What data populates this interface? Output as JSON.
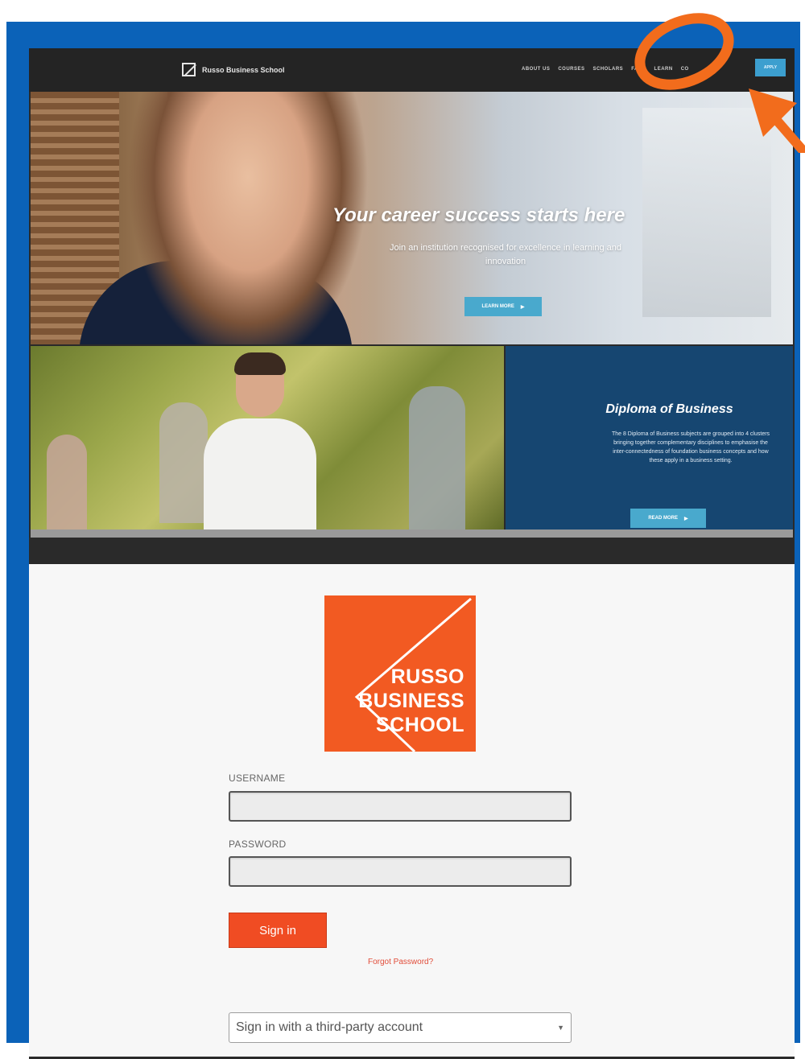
{
  "nav": {
    "brand": "Russo Business School",
    "links": [
      "ABOUT US",
      "COURSES",
      "SCHOLARS",
      "FAQS",
      "LEARN",
      "CO"
    ],
    "apply": "APPLY"
  },
  "hero": {
    "title": "Your career success starts here",
    "subtitle": "Join an institution recognised for excellence in learning and innovation",
    "button": "LEARN MORE",
    "button_arrow": "▶"
  },
  "diploma": {
    "title": "Diploma of Business",
    "text": "The 8 Diploma of Business subjects are grouped into 4 clusters bringing together complementary disciplines to emphasise the inter-connectedness of foundation business concepts and how these apply in a business setting.",
    "button": "READ MORE",
    "button_arrow": "▶"
  },
  "logo": {
    "lines": [
      "RUSSO",
      "BUSINESS",
      "SCHOOL"
    ]
  },
  "login": {
    "username_label": "USERNAME",
    "password_label": "PASSWORD",
    "username_value": "",
    "password_value": "",
    "sign_in": "Sign in",
    "forgot": "Forgot Password?",
    "third_party": "Sign in with a third-party account"
  },
  "colors": {
    "frame": "#0b62b8",
    "accent": "#f25a22",
    "annotation": "#f26c1c",
    "panel": "#164671",
    "button": "#49a9cd"
  }
}
